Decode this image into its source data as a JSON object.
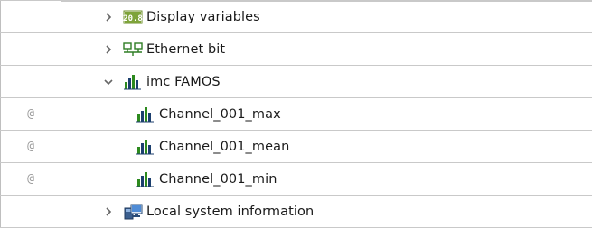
{
  "tree": {
    "rows": [
      {
        "label": "Display variables",
        "cell_text": "",
        "icon": "display-variables-icon",
        "expander": "collapsed"
      },
      {
        "label": "Ethernet bit",
        "cell_text": "",
        "icon": "ethernet-icon",
        "expander": "collapsed"
      },
      {
        "label": "imc FAMOS",
        "cell_text": "",
        "icon": "famos-icon",
        "expander": "expanded"
      },
      {
        "label": "Channel_001_max",
        "cell_text": "@",
        "icon": "famos-icon",
        "expander": "none"
      },
      {
        "label": "Channel_001_mean",
        "cell_text": "@",
        "icon": "famos-icon",
        "expander": "none"
      },
      {
        "label": "Channel_001_min",
        "cell_text": "@",
        "icon": "famos-icon",
        "expander": "none"
      },
      {
        "label": "Local system information",
        "cell_text": "",
        "icon": "computer-icon",
        "expander": "collapsed"
      }
    ]
  },
  "colors": {
    "grid_line": "#c9c9c9",
    "famos_green": "#2d8a1e",
    "famos_dark": "#1c3f6e",
    "display_box_bg": "#6b8f2a",
    "ethernet_green": "#3a8f2f",
    "chevron": "#666666"
  }
}
